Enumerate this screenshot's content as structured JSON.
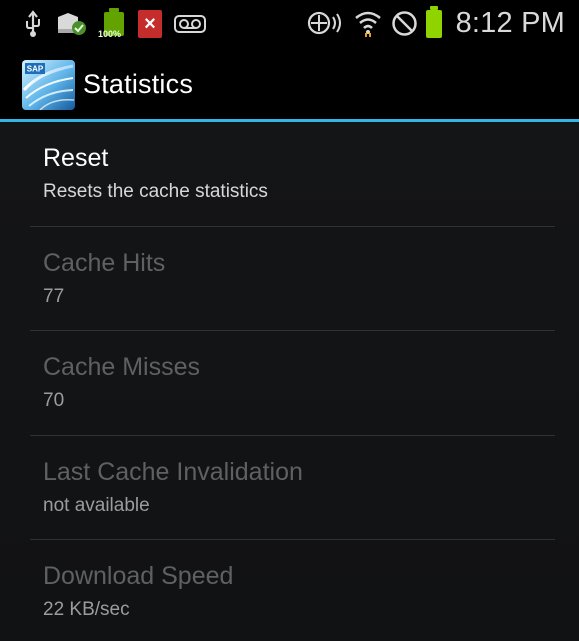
{
  "status_bar": {
    "time": "8:12 PM",
    "battery_label": "100%",
    "left_icons": [
      "usb-icon",
      "gallery-sync-icon",
      "battery-full-icon",
      "error-icon",
      "voicemail-icon"
    ],
    "right_icons": [
      "nfc-icon",
      "wifi-icon",
      "blocked-icon",
      "battery-icon"
    ]
  },
  "action_bar": {
    "title": "Statistics",
    "app_icon_label": "SAP"
  },
  "preferences": [
    {
      "title": "Reset",
      "summary": "Resets the cache statistics",
      "enabled": true
    },
    {
      "title": "Cache Hits",
      "summary": "77",
      "enabled": false
    },
    {
      "title": "Cache Misses",
      "summary": "70",
      "enabled": false
    },
    {
      "title": "Last Cache Invalidation",
      "summary": "not available",
      "enabled": false
    },
    {
      "title": "Download Speed",
      "summary": "22 KB/sec",
      "enabled": false
    }
  ],
  "colors": {
    "accent": "#33b5e5",
    "background": "#111214",
    "status_bar": "#000000",
    "battery": "#8fd400"
  }
}
